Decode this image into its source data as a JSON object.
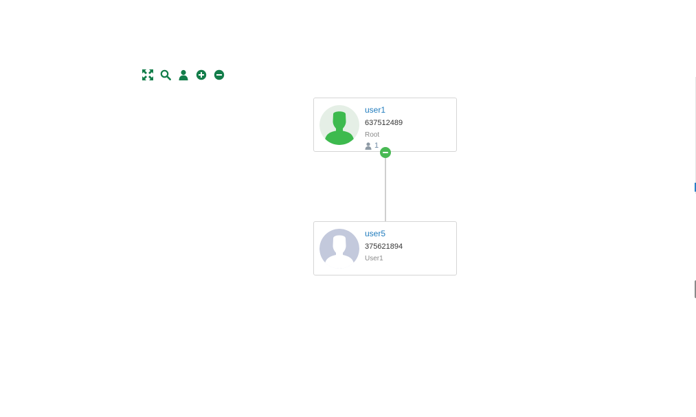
{
  "toolbar": {
    "icons": [
      "fullscreen-icon",
      "search-icon",
      "user-icon",
      "zoom-in-icon",
      "zoom-out-icon"
    ],
    "color": "#137d4a"
  },
  "tree": {
    "root": {
      "name": "user1",
      "phone": "637512489",
      "role": "Root",
      "child_count": "1",
      "avatar_icon": "user-silhouette-icon",
      "avatar_color": "#3dba4e"
    },
    "child": {
      "name": "user5",
      "phone": "375621894",
      "role": "User1",
      "avatar_icon": "default-avatar-icon",
      "avatar_color": "#c3c9dc"
    }
  },
  "colors": {
    "link": "#1f7bbd",
    "accent": "#49b954",
    "border": "#d5d5d5"
  }
}
